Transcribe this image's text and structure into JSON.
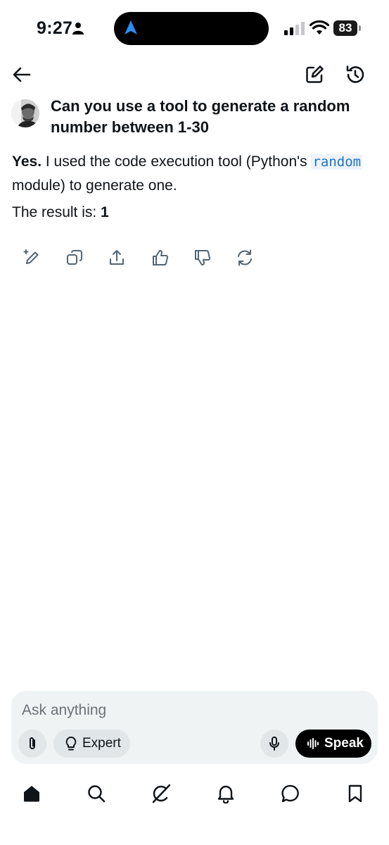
{
  "status_bar": {
    "time": "9:27",
    "battery": "83"
  },
  "conversation": {
    "question": "Can you use a tool to generate a random number between 1-30",
    "answer_bold": "Yes.",
    "answer_text_1": " I used the code execution tool (Python's ",
    "answer_code": "random",
    "answer_text_2": " module) to generate one.",
    "result_label": "The result is: ",
    "result_value": "1"
  },
  "composer": {
    "placeholder": "Ask anything",
    "expert_label": "Expert",
    "speak_label": "Speak"
  },
  "colors": {
    "code": "#1d74c8",
    "accent_dark": "#000000",
    "composer_bg": "#eff3f4"
  }
}
